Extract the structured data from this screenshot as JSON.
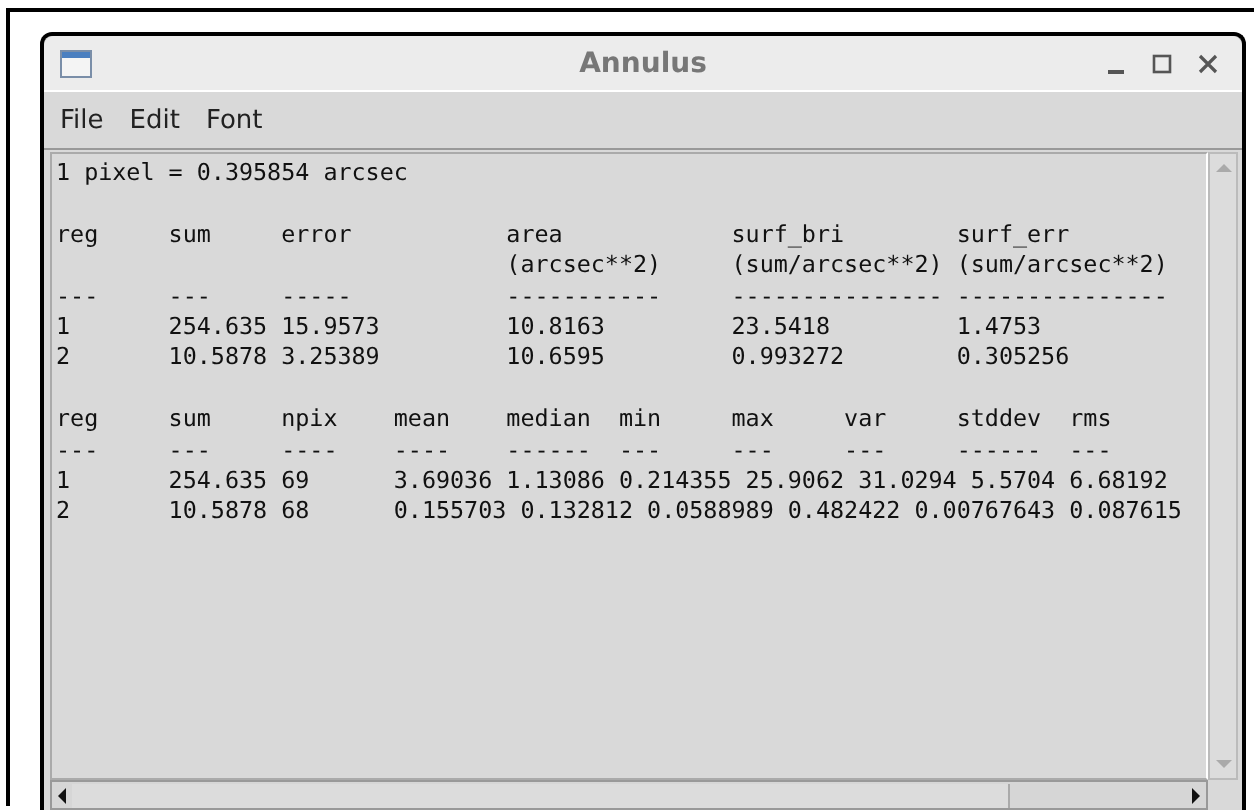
{
  "window": {
    "title": "Annulus"
  },
  "menu": [
    "File",
    "Edit",
    "Font"
  ],
  "scale_line": "1 pixel = 0.395854 arcsec",
  "tables": [
    [
      "reg     sum     error           area            surf_bri        surf_err",
      "                                (arcsec**2)     (sum/arcsec**2) (sum/arcsec**2)",
      "---     ---     -----           -----------     --------------- ---------------",
      "1       254.635 15.9573         10.8163         23.5418         1.4753",
      "2       10.5878 3.25389         10.6595         0.993272        0.305256"
    ],
    [
      "reg     sum     npix    mean    median  min     max     var     stddev  rms",
      "---     ---     ----    ----    ------  ---     ---     ---     ------  ---",
      "1       254.635 69      3.69036 1.13086 0.214355 25.9062 31.0294 5.5704 6.68192",
      "2       10.5878 68      0.155703 0.132812 0.0588989 0.482422 0.00767643 0.087615"
    ]
  ]
}
